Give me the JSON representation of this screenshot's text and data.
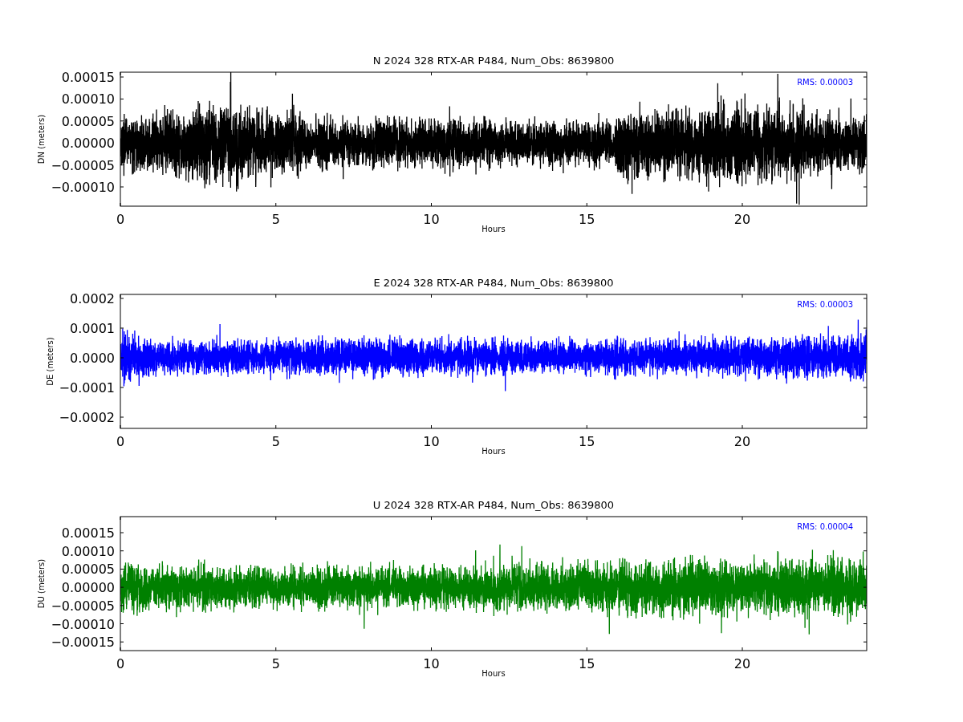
{
  "panels": [
    {
      "title": "N 2024 328 RTX-AR  P484, Num_Obs: 8639800",
      "rms": "RMS:  0.00003",
      "xlabel": "Hours",
      "ylabel": "DN (meters)",
      "color": "#000000",
      "xticks": [
        "0",
        "5",
        "10",
        "15",
        "20"
      ],
      "yticks": [
        "0.00015",
        "0.00010",
        "0.00005",
        "0.00000",
        "−0.00005",
        "−0.00010"
      ]
    },
    {
      "title": "E 2024 328 RTX-AR  P484, Num_Obs: 8639800",
      "rms": "RMS:  0.00003",
      "xlabel": "Hours",
      "ylabel": "DE (meters)",
      "color": "#0000ff",
      "xticks": [
        "0",
        "5",
        "10",
        "15",
        "20"
      ],
      "yticks": [
        "0.0002",
        "0.0001",
        "0.0000",
        "−0.0001",
        "−0.0002"
      ]
    },
    {
      "title": "U 2024 328 RTX-AR  P484, Num_Obs: 8639800",
      "rms": "RMS:  0.00004",
      "xlabel": "Hours",
      "ylabel": "DU (meters)",
      "color": "#008000",
      "xticks": [
        "0",
        "5",
        "10",
        "15",
        "20"
      ],
      "yticks": [
        "0.00015",
        "0.00010",
        "0.00005",
        "0.00000",
        "−0.00005",
        "−0.00010",
        "−0.00015"
      ]
    }
  ]
}
